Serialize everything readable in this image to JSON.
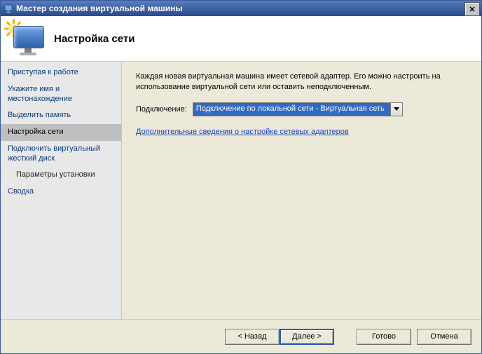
{
  "window": {
    "title": "Мастер создания виртуальной машины"
  },
  "header": {
    "heading": "Настройка сети"
  },
  "sidebar": {
    "steps": [
      {
        "label": "Приступая к работе",
        "active": false,
        "sub": false
      },
      {
        "label": "Укажите имя и местонахождение",
        "active": false,
        "sub": false
      },
      {
        "label": "Выделить память",
        "active": false,
        "sub": false
      },
      {
        "label": "Настройка сети",
        "active": true,
        "sub": false
      },
      {
        "label": "Подключить виртуальный жесткий диск",
        "active": false,
        "sub": false
      },
      {
        "label": "Параметры установки",
        "active": false,
        "sub": true
      },
      {
        "label": "Сводка",
        "active": false,
        "sub": false
      }
    ]
  },
  "main": {
    "description": "Каждая новая виртуальная машина имеет сетевой адаптер. Его можно настроить на использование виртуальной сети или оставить неподключенным.",
    "connection_label": "Подключение:",
    "connection_value": "Подключение по локальной сети - Виртуальная сеть",
    "more_info_link": "Дополнительные сведения о настройке сетевых адаптеров"
  },
  "footer": {
    "back": "< Назад",
    "next": "Далее >",
    "finish": "Готово",
    "cancel": "Отмена"
  }
}
